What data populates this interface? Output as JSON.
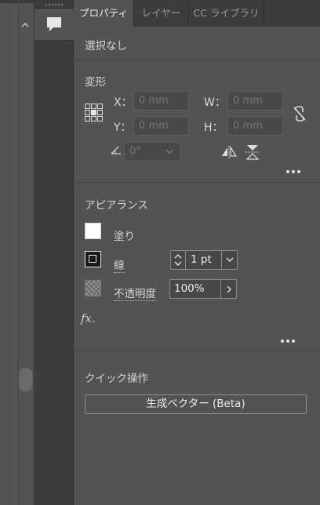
{
  "dock": {
    "icon": "comment-icon"
  },
  "tabs": [
    {
      "label": "プロパティ",
      "active": true
    },
    {
      "label": "レイヤー",
      "active": false
    },
    {
      "label": "CC ライブラリ",
      "active": false
    }
  ],
  "selection": {
    "status": "選択なし"
  },
  "transform": {
    "title": "変形",
    "x_label": "X：",
    "x_value": "0 mm",
    "y_label": "Y：",
    "y_value": "0 mm",
    "w_label": "W：",
    "w_value": "0 mm",
    "h_label": "H：",
    "h_value": "0 mm",
    "angle_value": "0°"
  },
  "appearance": {
    "title": "アピアランス",
    "fill_label": "塗り",
    "stroke_label": "線",
    "stroke_weight": "1 pt",
    "opacity_label": "不透明度",
    "opacity_value": "100%",
    "fx_label": "fx."
  },
  "quick_actions": {
    "title": "クイック操作",
    "button_label": "生成ベクター (Beta)"
  },
  "colors": {
    "panel": "#535353",
    "tabbar": "#3d3d3d",
    "text": "#d4d4d4",
    "field": "#494949"
  }
}
